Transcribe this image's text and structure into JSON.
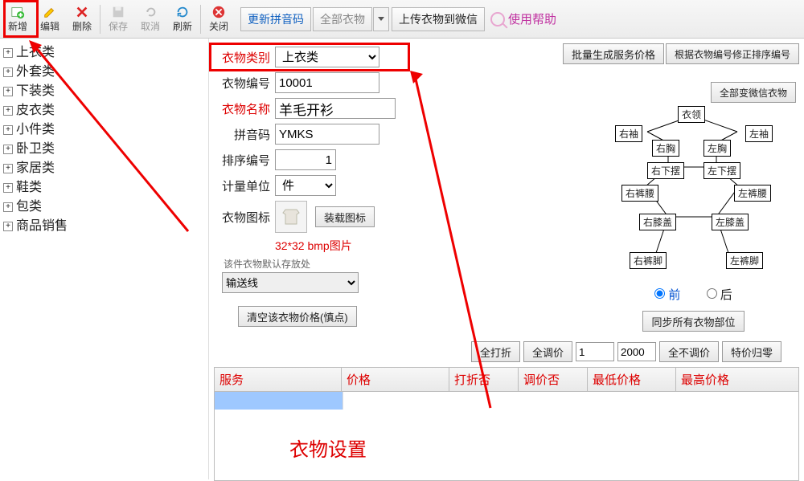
{
  "toolbar": {
    "new": "新增",
    "edit": "编辑",
    "delete": "删除",
    "save": "保存",
    "cancel": "取消",
    "refresh": "刷新",
    "close": "关闭",
    "update_pinyin": "更新拼音码",
    "all_clothes": "全部衣物",
    "upload_wechat": "上传衣物到微信",
    "help": "使用帮助"
  },
  "top_right": {
    "batch_price": "批量生成服务价格",
    "fix_sort": "根据衣物编号修正排序编号",
    "all_wechat": "全部变微信衣物"
  },
  "tree": [
    "上衣类",
    "外套类",
    "下装类",
    "皮衣类",
    "小件类",
    "卧卫类",
    "家居类",
    "鞋类",
    "包类",
    "商品销售"
  ],
  "form": {
    "category_label": "衣物类别",
    "category_value": "上衣类",
    "code_label": "衣物编号",
    "code_value": "10001",
    "name_label": "衣物名称",
    "name_value": "羊毛开衫",
    "pinyin_label": "拼音码",
    "pinyin_value": "YMKS",
    "sort_label": "排序编号",
    "sort_value": "1",
    "unit_label": "计量单位",
    "unit_value": "件",
    "icon_label": "衣物图标",
    "load_icon": "装载图标",
    "icon_note": "32*32 bmp图片",
    "storage_hint": "该件衣物默认存放处",
    "storage_value": "输送线",
    "clear_price": "清空该衣物价格(慎点)"
  },
  "diagram": {
    "collar": "衣领",
    "r_sleeve": "右袖",
    "l_sleeve": "左袖",
    "r_chest": "右胸",
    "l_chest": "左胸",
    "r_hem": "右下摆",
    "l_hem": "左下摆",
    "r_waist": "右裤腰",
    "l_waist": "左裤腰",
    "r_knee": "右膝盖",
    "l_knee": "左膝盖",
    "r_ankle": "右裤脚",
    "l_ankle": "左裤脚"
  },
  "view": {
    "front": "前",
    "back": "后",
    "sync": "同步所有衣物部位"
  },
  "price": {
    "all_discount": "全打折",
    "all_adjust": "全调价",
    "v1": "1",
    "v2": "2000",
    "no_adjust": "全不调价",
    "reset_special": "特价归零"
  },
  "grid": {
    "service": "服务",
    "price": "价格",
    "discount": "打折否",
    "adjust": "调价否",
    "min": "最低价格",
    "max": "最高价格"
  },
  "big_label": "衣物设置"
}
